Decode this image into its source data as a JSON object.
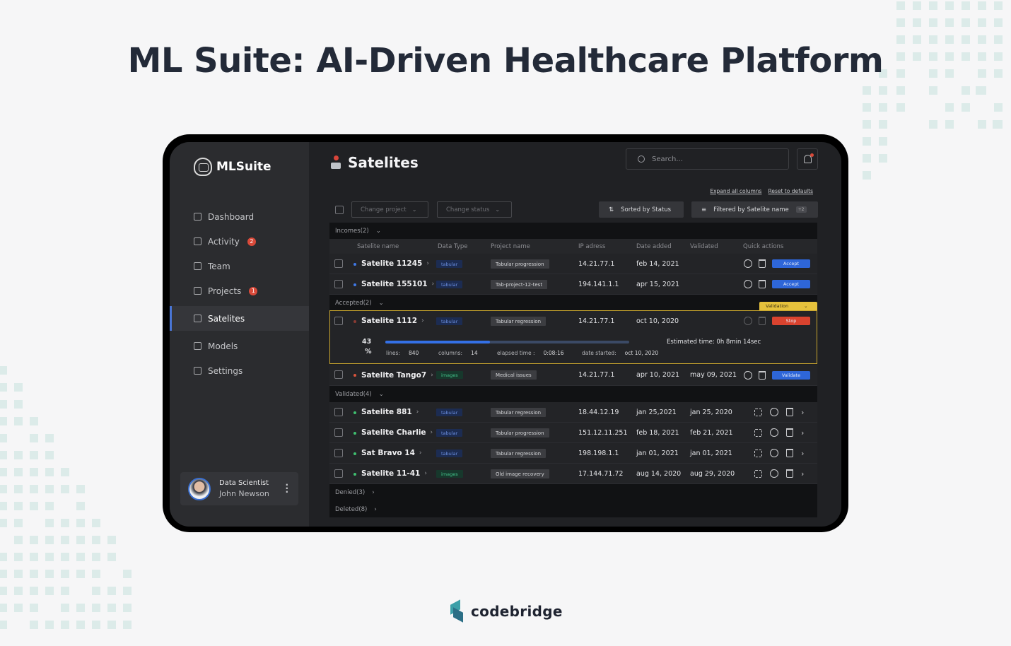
{
  "headline": "ML Suite: AI-Driven Healthcare Platform",
  "brand": {
    "name": "MLSuite",
    "footer_logo": "codebridge"
  },
  "colors": {
    "accent_blue": "#2e66d8",
    "danger_red": "#d9432f",
    "validation_yellow": "#e6c23c",
    "sidebar_bg": "#2b2c2f"
  },
  "sidebar": {
    "items": [
      {
        "label": "Dashboard",
        "icon": "dashboard-icon",
        "badge": ""
      },
      {
        "label": "Activity",
        "icon": "activity-icon",
        "badge": "2"
      },
      {
        "label": "Team",
        "icon": "team-icon",
        "badge": ""
      },
      {
        "label": "Projects",
        "icon": "folder-icon",
        "badge": "1"
      },
      {
        "label": "Satelites",
        "icon": "satelite-icon",
        "badge": "",
        "active": true
      },
      {
        "label": "Models",
        "icon": "models-icon",
        "badge": ""
      },
      {
        "label": "Settings",
        "icon": "gear-icon",
        "badge": ""
      }
    ],
    "user": {
      "role": "Data Scientist",
      "name": "John Newson"
    }
  },
  "header": {
    "title": "Satelites",
    "search_placeholder": "Search..."
  },
  "links": {
    "expand": "Expand all columns",
    "reset": "Reset to defaults"
  },
  "toolbar": {
    "change_project": "Change project",
    "change_status": "Change status",
    "sorted": "Sorted by Status",
    "filtered": "Filtered by Satelite name",
    "filter_count": "+2"
  },
  "table": {
    "columns": [
      "Satelite name",
      "Data Type",
      "Project name",
      "IP adress",
      "Date added",
      "Validated",
      "Quick actions"
    ],
    "groups": {
      "incomes": "Incomes(2)",
      "accepted": "Accepted(2)",
      "validated": "Validated(4)",
      "denied": "Denied(3)",
      "deleted": "Deleted(8)"
    },
    "incomes": [
      {
        "name": "Satelite 11245",
        "type": "tabular",
        "project": "Tabular progression",
        "ip": "14.21.77.1",
        "added": "feb 14, 2021",
        "validated": "",
        "action": "Accept"
      },
      {
        "name": "Satelite 155101",
        "type": "tabular",
        "project": "Tab-project-12-test",
        "ip": "194.141.1.1",
        "added": "apr 15, 2021",
        "validated": "",
        "action": "Accept"
      }
    ],
    "accepted_active": {
      "name": "Satelite 1112",
      "type": "tabular",
      "project": "Tabular regression",
      "ip": "14.21.77.1",
      "added": "oct 10, 2020",
      "action": "Stop",
      "badge": "Validation",
      "progress_value": "43",
      "progress_unit": "%",
      "progress_fraction": 0.43,
      "lines_label": "lines:",
      "lines": "840",
      "columns_label": "columns:",
      "columns": "14",
      "elapsed_label": "elapsed time :",
      "elapsed": "0:08:16",
      "started_label": "date started:",
      "started": "oct 10, 2020",
      "estimate": "Estimated time: 0h 8min 14sec"
    },
    "accepted_other": {
      "name": "Satelite Tango7",
      "type": "images",
      "project": "Medical issues",
      "ip": "14.21.77.1",
      "added": "apr 10, 2021",
      "validated": "may 09, 2021",
      "action": "Validate"
    },
    "validated": [
      {
        "name": "Satelite 881",
        "type": "tabular",
        "project": "Tabular regression",
        "ip": "18.44.12.19",
        "added": "jan 25,2021",
        "validated": "jan 25, 2020"
      },
      {
        "name": "Satelite Charlie",
        "type": "tabular",
        "project": "Tabular progression",
        "ip": "151.12.11.251",
        "added": "feb 18, 2021",
        "validated": "feb 21, 2021"
      },
      {
        "name": "Sat Bravo 14",
        "type": "tabular",
        "project": "Tabular regression",
        "ip": "198.198.1.1",
        "added": "jan 01, 2021",
        "validated": "jan 01, 2021"
      },
      {
        "name": "Satelite 11-41",
        "type": "images",
        "project": "Old image recovery",
        "ip": "17.144.71.72",
        "added": "aug 14, 2020",
        "validated": "aug 29, 2020"
      }
    ]
  }
}
